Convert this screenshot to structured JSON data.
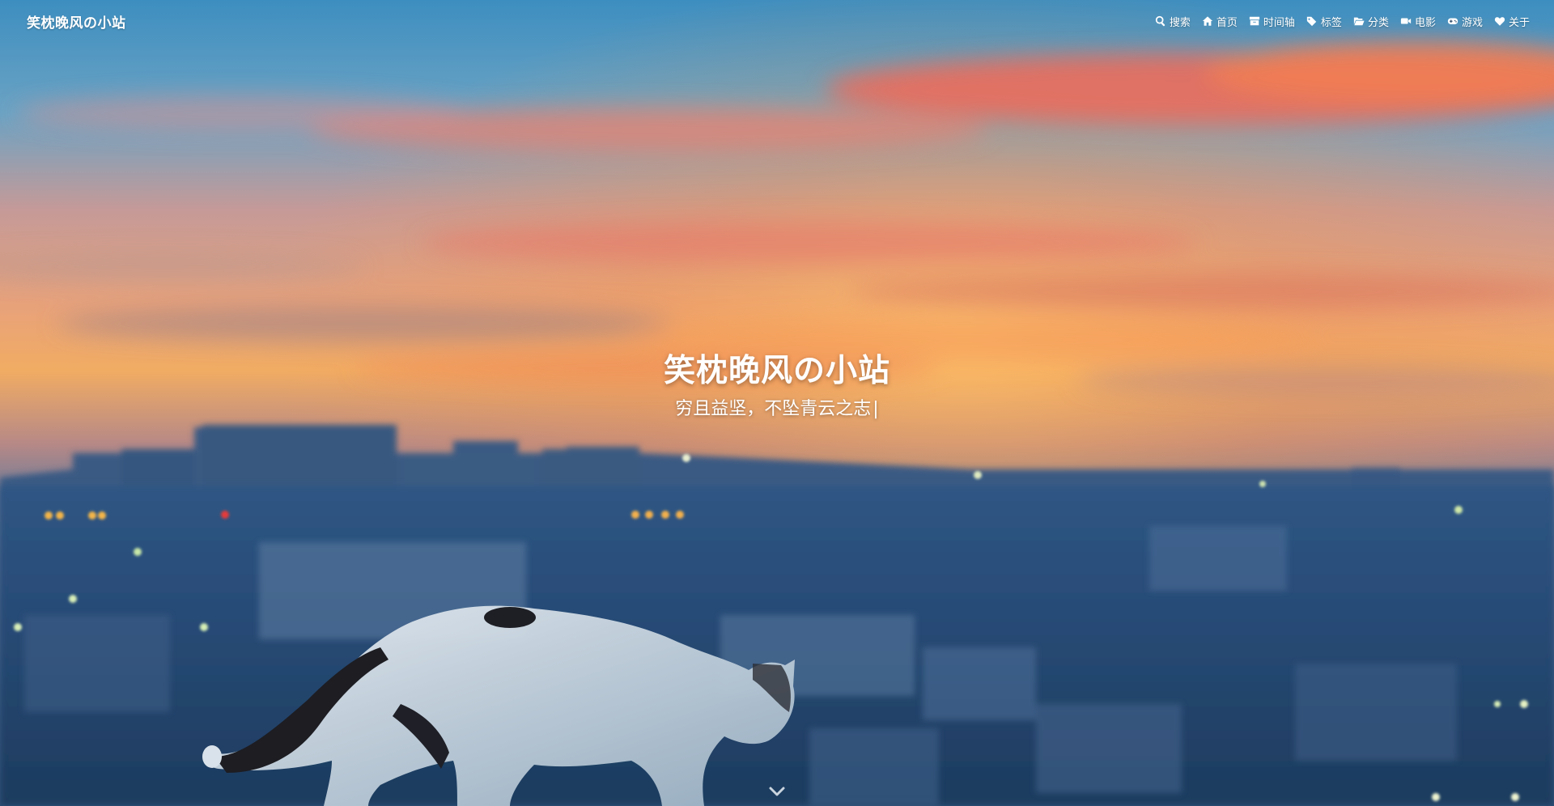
{
  "site": {
    "brand": "笑枕晚风の小站"
  },
  "nav": {
    "items": [
      {
        "label": "搜索",
        "icon": "search-icon"
      },
      {
        "label": "首页",
        "icon": "home-icon"
      },
      {
        "label": "时间轴",
        "icon": "archive-icon"
      },
      {
        "label": "标签",
        "icon": "tags-icon"
      },
      {
        "label": "分类",
        "icon": "folder-open-icon"
      },
      {
        "label": "电影",
        "icon": "video-camera-icon"
      },
      {
        "label": "游戏",
        "icon": "gamepad-icon"
      },
      {
        "label": "关于",
        "icon": "heart-icon"
      }
    ]
  },
  "hero": {
    "title": "笑枕晚风の小站",
    "subtitle": "穷且益坚，不坠青云之志",
    "cursor": "|",
    "background": "blurred sunset city skyline with a cat walking on a ledge",
    "scroll_icon": "chevron-down-icon"
  },
  "colors": {
    "text": "#ffffff",
    "sky_top": "#3a86b8",
    "sunset_red": "#ef5e52",
    "sunset_orange": "#f6a646",
    "city_blue": "#254a70"
  }
}
